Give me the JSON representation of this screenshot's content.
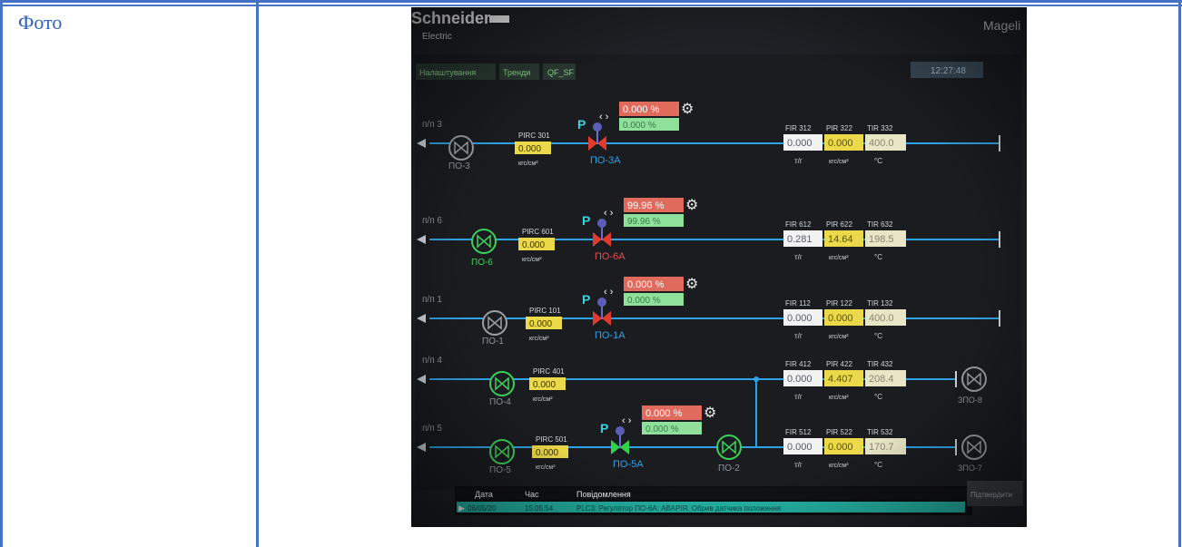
{
  "document": {
    "label": "Фото"
  },
  "hmi": {
    "brand_name": "Schneider",
    "brand_sub": "Electric",
    "corner_text": "Mageli",
    "tabs": [
      "Налаштування",
      "Тренди",
      "QF_SF"
    ],
    "clock": "12:27:48",
    "units": {
      "flow": "т/г",
      "pressure": "кгс/см²",
      "temp": "°C"
    },
    "lines": [
      {
        "line": "п/п 3",
        "pump": "ПО-3",
        "pirc": "PIRC 301",
        "pirc_value": "0.000",
        "valve": "ПО-3А",
        "sp": "0.000 %",
        "out": "0.000 %",
        "h": [
          "FIR 312",
          "PIR 322",
          "TIR 332"
        ],
        "v": [
          "0.000",
          "0.000",
          "400.0"
        ]
      },
      {
        "line": "п/п 6",
        "pump": "ПО-6",
        "pirc": "PIRC 601",
        "pirc_value": "0.000",
        "valve": "ПО-6А",
        "sp": "99.96 %",
        "out": "99.96 %",
        "h": [
          "FIR 612",
          "PIR 622",
          "TIR 632"
        ],
        "v": [
          "0.281",
          "14.64",
          "198.5"
        ]
      },
      {
        "line": "п/п 1",
        "pump": "ПО-1",
        "pirc": "PIRC 101",
        "pirc_value": "0.000",
        "valve": "ПО-1А",
        "sp": "0.000 %",
        "out": "0.000 %",
        "h": [
          "FIR 112",
          "PIR 122",
          "TIR 132"
        ],
        "v": [
          "0.000",
          "0.000",
          "400.0"
        ]
      },
      {
        "line": "п/п 4",
        "pump": "ПО-4",
        "pirc": "PIRC 401",
        "pirc_value": "0.000",
        "h": [
          "FIR 412",
          "PIR 422",
          "TIR 432"
        ],
        "v": [
          "0.000",
          "4.407",
          "208.4"
        ],
        "aux_pump": "ЗПО-8"
      },
      {
        "line": "п/п 5",
        "pump": "ПО-5",
        "pirc": "PIRC 501",
        "pirc_value": "0.000",
        "valve": "ПО-5А",
        "sp": "0.000 %",
        "out": "0.000 %",
        "h": [
          "FIR 512",
          "PIR 522",
          "TIR 532"
        ],
        "v": [
          "0.000",
          "0.000",
          "170.7"
        ],
        "aux_pump": "ЗПО-7",
        "pump2": "ПО-2"
      }
    ],
    "alarms": {
      "headers": [
        "Дата",
        "Час",
        "Повідомлення"
      ],
      "row": {
        "date": "06/05/20",
        "time": "15:05:54",
        "message": "PLC3: Регулятор ПО-6А: АВАРІЯ. Обрив датчика положення"
      },
      "ack_button": "Підтвердити"
    },
    "colors": {
      "accent": "#2fa3e6",
      "sp_bg": "#e06a5c",
      "out_bg": "#8ee09a",
      "value_bg": "#ecd949",
      "pump_green": "#3bd25a",
      "valve_red": "#e23a2c",
      "valve_green": "#2fd24a",
      "alarm_bar": "#25b8a8"
    }
  }
}
